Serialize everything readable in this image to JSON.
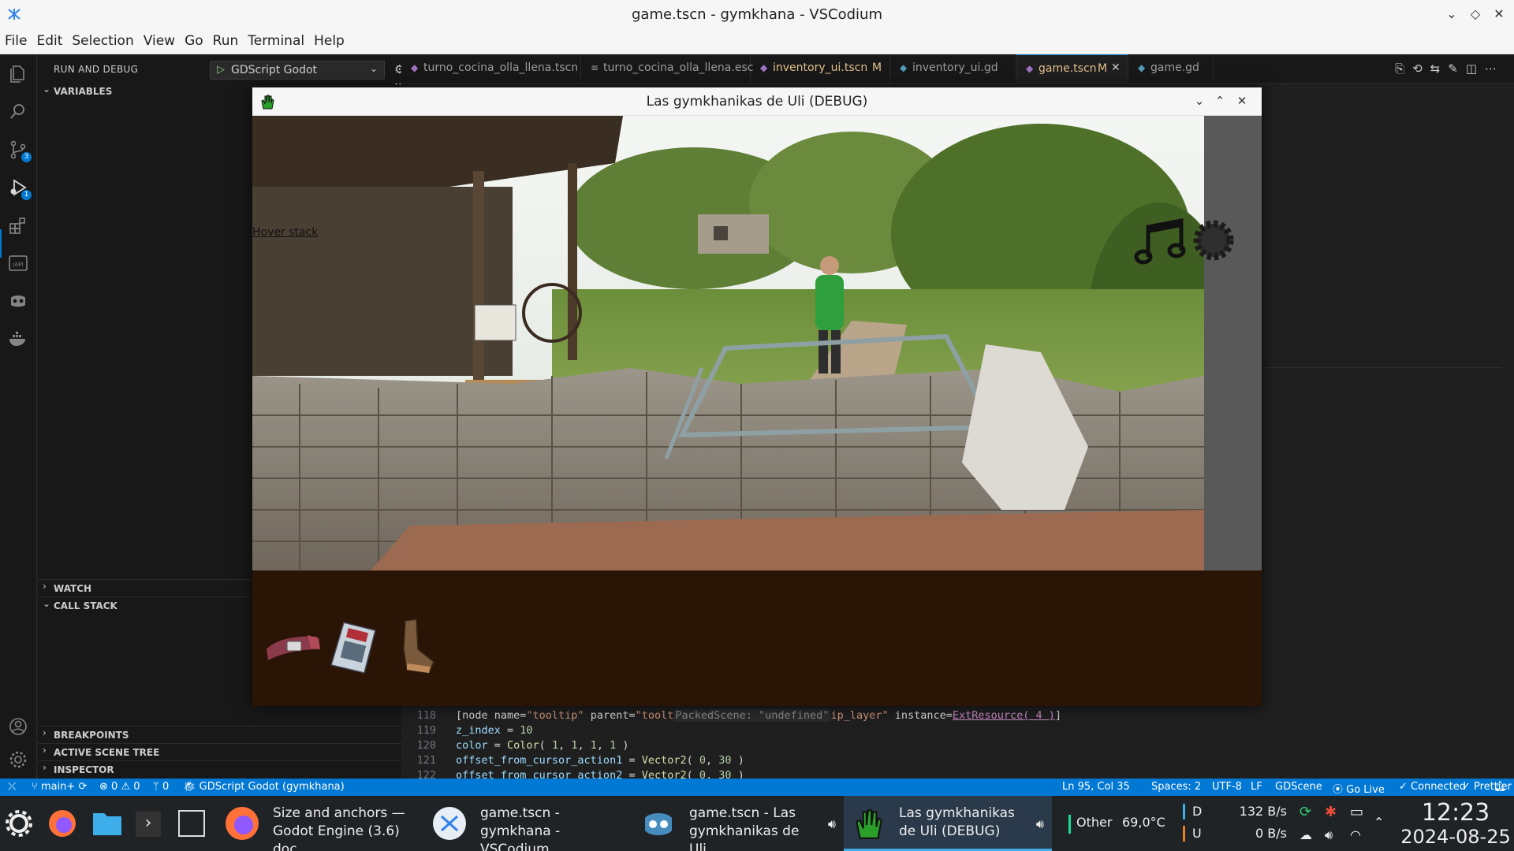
{
  "window": {
    "title": "game.tscn - gymkhana - VSCodium"
  },
  "menubar": [
    "File",
    "Edit",
    "Selection",
    "View",
    "Go",
    "Run",
    "Terminal",
    "Help"
  ],
  "activitybar": {
    "icons": [
      "explorer-icon",
      "search-icon",
      "source-control-icon",
      "run-debug-icon",
      "extensions-icon",
      "api-icon",
      "godot-icon",
      "docker-icon",
      "account-icon",
      "manage-gear-icon"
    ],
    "source_control_badge": "3",
    "debug_badge": "1"
  },
  "sidebar": {
    "header": "RUN AND DEBUG",
    "debug_config": "GDScript Godot",
    "sections": {
      "variables": "VARIABLES",
      "watch": "WATCH",
      "call_stack": "CALL STACK",
      "breakpoints": "BREAKPOINTS",
      "active_scene_tree": "ACTIVE SCENE TREE",
      "inspector": "INSPECTOR"
    }
  },
  "tabs": [
    {
      "label": "turno_cocina_olla_llena.tscn",
      "mark": "",
      "icon": "scene-icon"
    },
    {
      "label": "turno_cocina_olla_llena.esc",
      "mark": "",
      "icon": "text-icon"
    },
    {
      "label": "inventory_ui.tscn",
      "mark": "M",
      "icon": "scene-icon"
    },
    {
      "label": "inventory_ui.gd",
      "mark": "",
      "icon": "gdscript-icon"
    },
    {
      "label": "game.tscn",
      "mark": "M",
      "icon": "scene-icon",
      "active": true
    },
    {
      "label": "game.gd",
      "mark": "",
      "icon": "gdscript-icon"
    }
  ],
  "code": {
    "lines": [
      {
        "n": "118",
        "parts": [
          [
            "[node name=",
            "plain"
          ],
          [
            "\"tooltip\"",
            "str"
          ],
          [
            " parent=",
            "plain"
          ],
          [
            "\"toolt",
            "str"
          ],
          [
            "PackedScene: \"undefined\"",
            "hint"
          ],
          [
            "ip_layer\"",
            "str"
          ],
          [
            " instance=",
            "plain"
          ],
          [
            "ExtResource( 4 )",
            "link"
          ],
          [
            "]",
            "plain"
          ]
        ]
      },
      {
        "n": "119",
        "parts": [
          [
            "z_index",
            "key"
          ],
          [
            " = ",
            "plain"
          ],
          [
            "10",
            "num"
          ]
        ]
      },
      {
        "n": "120",
        "parts": [
          [
            "color",
            "key"
          ],
          [
            " = ",
            "plain"
          ],
          [
            "Color",
            "fn"
          ],
          [
            "( ",
            "plain"
          ],
          [
            "1",
            "num"
          ],
          [
            ", ",
            "plain"
          ],
          [
            "1",
            "num"
          ],
          [
            ", ",
            "plain"
          ],
          [
            "1",
            "num"
          ],
          [
            ", ",
            "plain"
          ],
          [
            "1",
            "num"
          ],
          [
            " )",
            "plain"
          ]
        ]
      },
      {
        "n": "121",
        "parts": [
          [
            "offset_from_cursor_action1",
            "key"
          ],
          [
            " = ",
            "plain"
          ],
          [
            "Vector2",
            "fn"
          ],
          [
            "( ",
            "plain"
          ],
          [
            "0",
            "num"
          ],
          [
            ", ",
            "plain"
          ],
          [
            "30",
            "num"
          ],
          [
            " )",
            "plain"
          ]
        ]
      },
      {
        "n": "122",
        "parts": [
          [
            "offset_from_cursor_action2",
            "key"
          ],
          [
            " = ",
            "plain"
          ],
          [
            "Vector2",
            "fn"
          ],
          [
            "( ",
            "plain"
          ],
          [
            "0",
            "num"
          ],
          [
            ", ",
            "plain"
          ],
          [
            "30",
            "num"
          ],
          [
            " )",
            "plain"
          ]
        ]
      }
    ]
  },
  "game_window": {
    "title": "Las gymkhanikas de Uli (DEBUG)",
    "hover_stack": "Hover stack",
    "inventory_items": [
      "belt-item",
      "magazine-item",
      "boot-item"
    ]
  },
  "statusbar": {
    "branch": "main+",
    "problems_errors": "0",
    "problems_warnings": "0",
    "ports": "0",
    "debug_session": "GDScript Godot (gymkhana)",
    "position": "Ln 95, Col 35",
    "spaces": "Spaces: 2",
    "encoding": "UTF-8",
    "eol": "LF",
    "language": "GDScene",
    "go_live": "Go Live",
    "connected": "Connected",
    "prettier": "Prettier"
  },
  "taskbar": {
    "tasks": [
      {
        "label": "Size and anchors — Godot Engine (3.6) doc...",
        "icon": "firefox-icon"
      },
      {
        "label": "game.tscn - gymkhana - VSCodium",
        "icon": "vscodium-icon"
      },
      {
        "label": "game.tscn - Las gymkhanikas de Uli...",
        "icon": "godot-icon"
      },
      {
        "label": "Las gymkhanikas de Uli (DEBUG)",
        "icon": "game-hand-icon",
        "active": true
      }
    ],
    "sysmon_label": "Other",
    "sysmon_temp": "69,0°C",
    "net_down_label": "D",
    "net_up_label": "U",
    "net_down": "132 B/s",
    "net_up": "0 B/s",
    "time": "12:23",
    "date": "2024-08-25"
  },
  "colors": {
    "accent": "#0078d4",
    "statusbar": "#0078d4",
    "modified": "#e2c08d",
    "inventory_bg": "#2a1406"
  }
}
